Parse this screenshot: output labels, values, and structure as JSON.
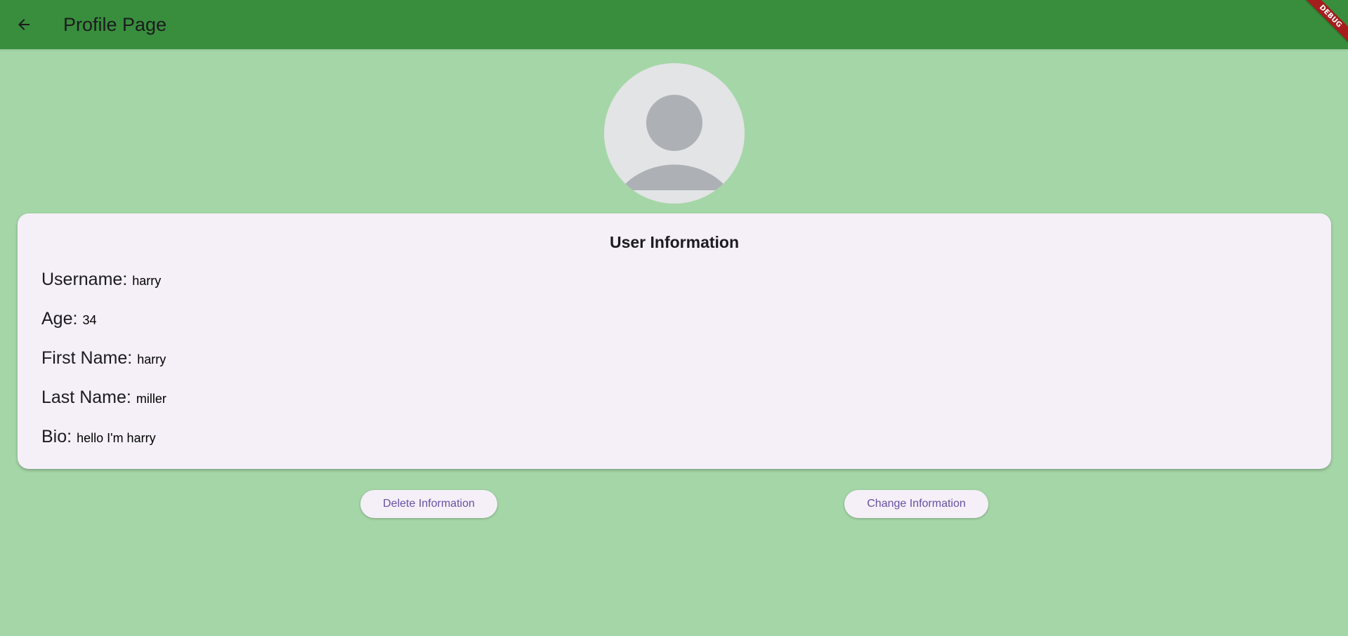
{
  "appbar": {
    "title": "Profile Page",
    "back_icon": "arrow-back-icon",
    "background": "#388e3c"
  },
  "debug_banner": "DEBUG",
  "avatar": {
    "icon": "person-placeholder-icon"
  },
  "card": {
    "title": "User Information",
    "fields": [
      {
        "label": "Username:",
        "value": "harry"
      },
      {
        "label": "Age:",
        "value": "34"
      },
      {
        "label": "First Name:",
        "value": "harry"
      },
      {
        "label": "Last Name:",
        "value": "miller"
      },
      {
        "label": "Bio:",
        "value": "hello I'm harry"
      }
    ]
  },
  "actions": {
    "delete_label": "Delete Information",
    "change_label": "Change Information"
  },
  "colors": {
    "page_background": "#a5d6a7",
    "card_background": "#f5f0f8",
    "button_text": "#6750a4"
  }
}
